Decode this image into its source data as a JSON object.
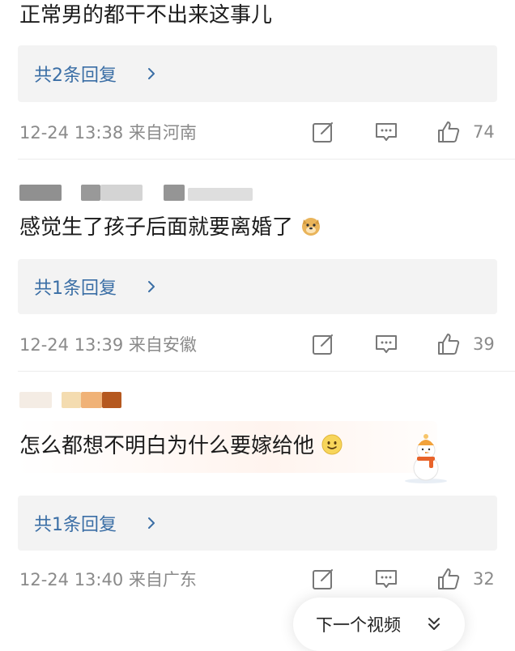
{
  "comments": [
    {
      "text": "正常男的都干不出来这事儿",
      "reply_label": "共2条回复",
      "meta": "12-24 13:38 来自河南",
      "likes": "74"
    },
    {
      "text": "感觉生了孩子后面就要离婚了",
      "reply_label": "共1条回复",
      "meta": "12-24 13:39 来自安徽",
      "likes": "39"
    },
    {
      "text": "怎么都想不明白为什么要嫁给他",
      "reply_label": "共1条回复",
      "meta": "12-24 13:40 来自广东",
      "likes": "32"
    }
  ],
  "next_video": {
    "label": "下一个视频"
  },
  "icons": {
    "edit": "edit-share-icon",
    "comment": "comment-icon",
    "like": "thumbs-up-icon",
    "reply_arrow": "chevron-right-icon",
    "next_arrow": "double-chevron-down-icon",
    "emoji_doge": "doge-emoji-icon",
    "emoji_smile": "smile-emoji-icon",
    "sticker": "snowman-sticker-icon"
  },
  "colors": {
    "reply_link": "#3a6ea5",
    "meta_gray": "#8a8a8a",
    "reply_bg": "#f3f3f3"
  }
}
